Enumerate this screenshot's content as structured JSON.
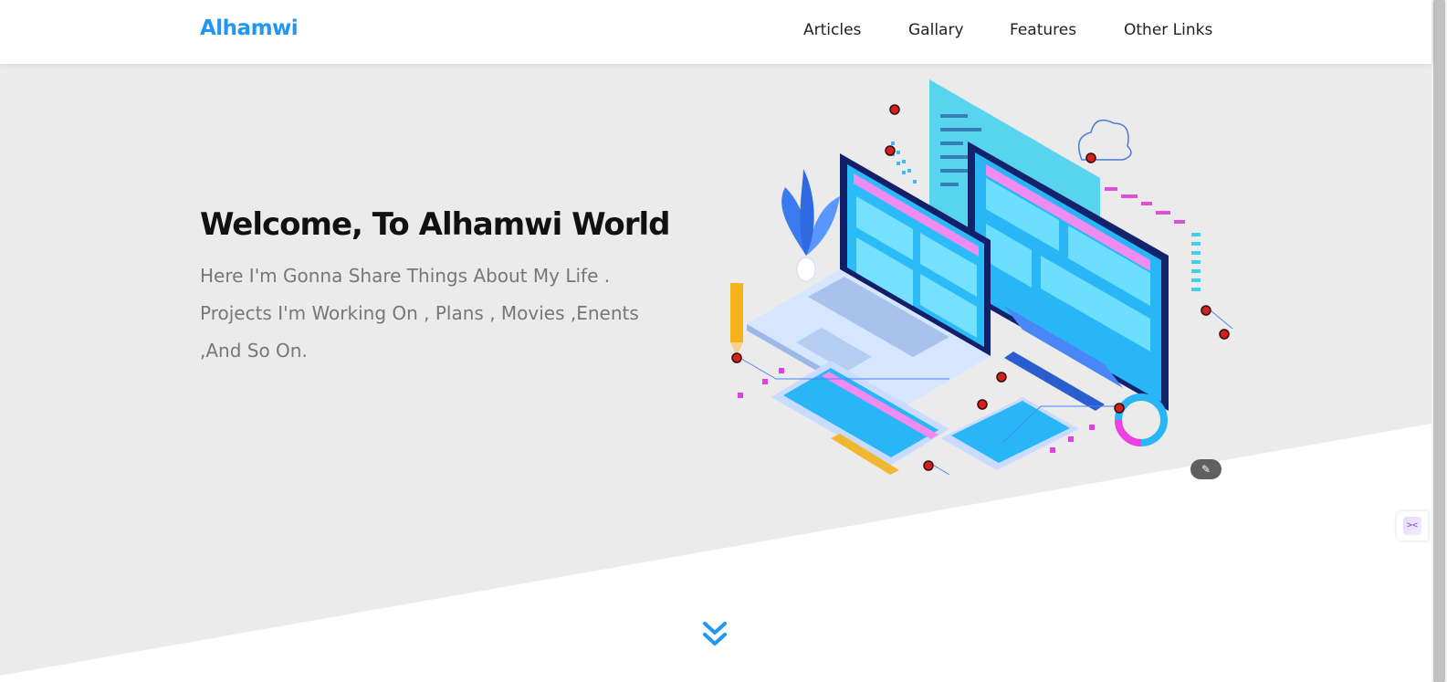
{
  "header": {
    "logo": "Alhamwi",
    "nav": [
      {
        "label": "Articles"
      },
      {
        "label": "Gallary"
      },
      {
        "label": "Features"
      },
      {
        "label": "Other Links"
      }
    ]
  },
  "landing": {
    "title": "Welcome, To Alhamwi World",
    "description": "Here I'm Gonna Share Things About My Life . Projects I'm Working On , Plans , Movies ,Enents ,And So On.",
    "illustration_icon": "devices-illustration",
    "go_down_icon": "double-chevron-down-icon"
  },
  "colors": {
    "accent": "#2196f3",
    "landing_bg": "#ebebeb",
    "text_muted": "#777777"
  },
  "extension_badge_icon": "magic-wand-icon",
  "side_widget_icon": "code-brackets-icon"
}
